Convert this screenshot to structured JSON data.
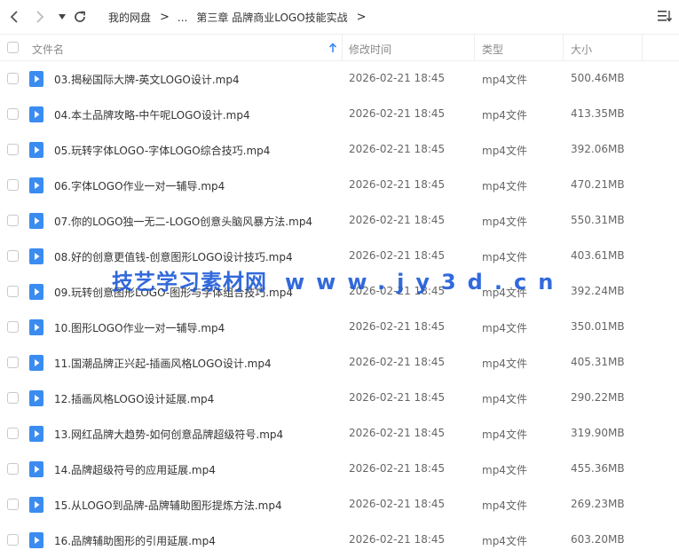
{
  "toolbar": {
    "breadcrumbs": [
      "我的网盘",
      "...",
      "第三章 品牌商业LOGO技能实战"
    ],
    "icons": {
      "back": "chevron-left-icon",
      "forward": "chevron-right-icon",
      "history": "caret-down-icon",
      "refresh": "refresh-icon",
      "sort": "sort-icon"
    }
  },
  "header": {
    "name": "文件名",
    "modified": "修改时间",
    "type": "类型",
    "size": "大小"
  },
  "colors": {
    "accent": "#3b8cf0",
    "watermark": "#1c59d8"
  },
  "files": [
    {
      "name": "03.揭秘国际大牌-英文LOGO设计.mp4",
      "date": "2026-02-21 18:45",
      "type": "mp4文件",
      "size": "500.46MB"
    },
    {
      "name": "04.本土品牌攻略-中午呢LOGO设计.mp4",
      "date": "2026-02-21 18:45",
      "type": "mp4文件",
      "size": "413.35MB"
    },
    {
      "name": "05.玩转字体LOGO-字体LOGO综合技巧.mp4",
      "date": "2026-02-21 18:45",
      "type": "mp4文件",
      "size": "392.06MB"
    },
    {
      "name": "06.字体LOGO作业一对一辅导.mp4",
      "date": "2026-02-21 18:45",
      "type": "mp4文件",
      "size": "470.21MB"
    },
    {
      "name": "07.你的LOGO独一无二-LOGO创意头脑风暴方法.mp4",
      "date": "2026-02-21 18:45",
      "type": "mp4文件",
      "size": "550.31MB"
    },
    {
      "name": "08.好的创意更值钱-创意图形LOGO设计技巧.mp4",
      "date": "2026-02-21 18:45",
      "type": "mp4文件",
      "size": "403.61MB"
    },
    {
      "name": "09.玩转创意图形LOGO-图形与字体组合技巧.mp4",
      "date": "2026-02-21 18:45",
      "type": "mp4文件",
      "size": "392.24MB"
    },
    {
      "name": "10.图形LOGO作业一对一辅导.mp4",
      "date": "2026-02-21 18:45",
      "type": "mp4文件",
      "size": "350.01MB"
    },
    {
      "name": "11.国潮品牌正兴起-插画风格LOGO设计.mp4",
      "date": "2026-02-21 18:45",
      "type": "mp4文件",
      "size": "405.31MB"
    },
    {
      "name": "12.插画风格LOGO设计延展.mp4",
      "date": "2026-02-21 18:45",
      "type": "mp4文件",
      "size": "290.22MB"
    },
    {
      "name": "13.网红品牌大趋势-如何创意品牌超级符号.mp4",
      "date": "2026-02-21 18:45",
      "type": "mp4文件",
      "size": "319.90MB"
    },
    {
      "name": "14.品牌超级符号的应用延展.mp4",
      "date": "2026-02-21 18:45",
      "type": "mp4文件",
      "size": "455.36MB"
    },
    {
      "name": "15.从LOGO到品牌-品牌辅助图形提炼方法.mp4",
      "date": "2026-02-21 18:45",
      "type": "mp4文件",
      "size": "269.23MB"
    },
    {
      "name": "16.品牌辅助图形的引用延展.mp4",
      "date": "2026-02-21 18:45",
      "type": "mp4文件",
      "size": "603.20MB"
    }
  ],
  "watermark": {
    "brand": "技艺学习素材网",
    "url": "www.jy3d.cn"
  }
}
